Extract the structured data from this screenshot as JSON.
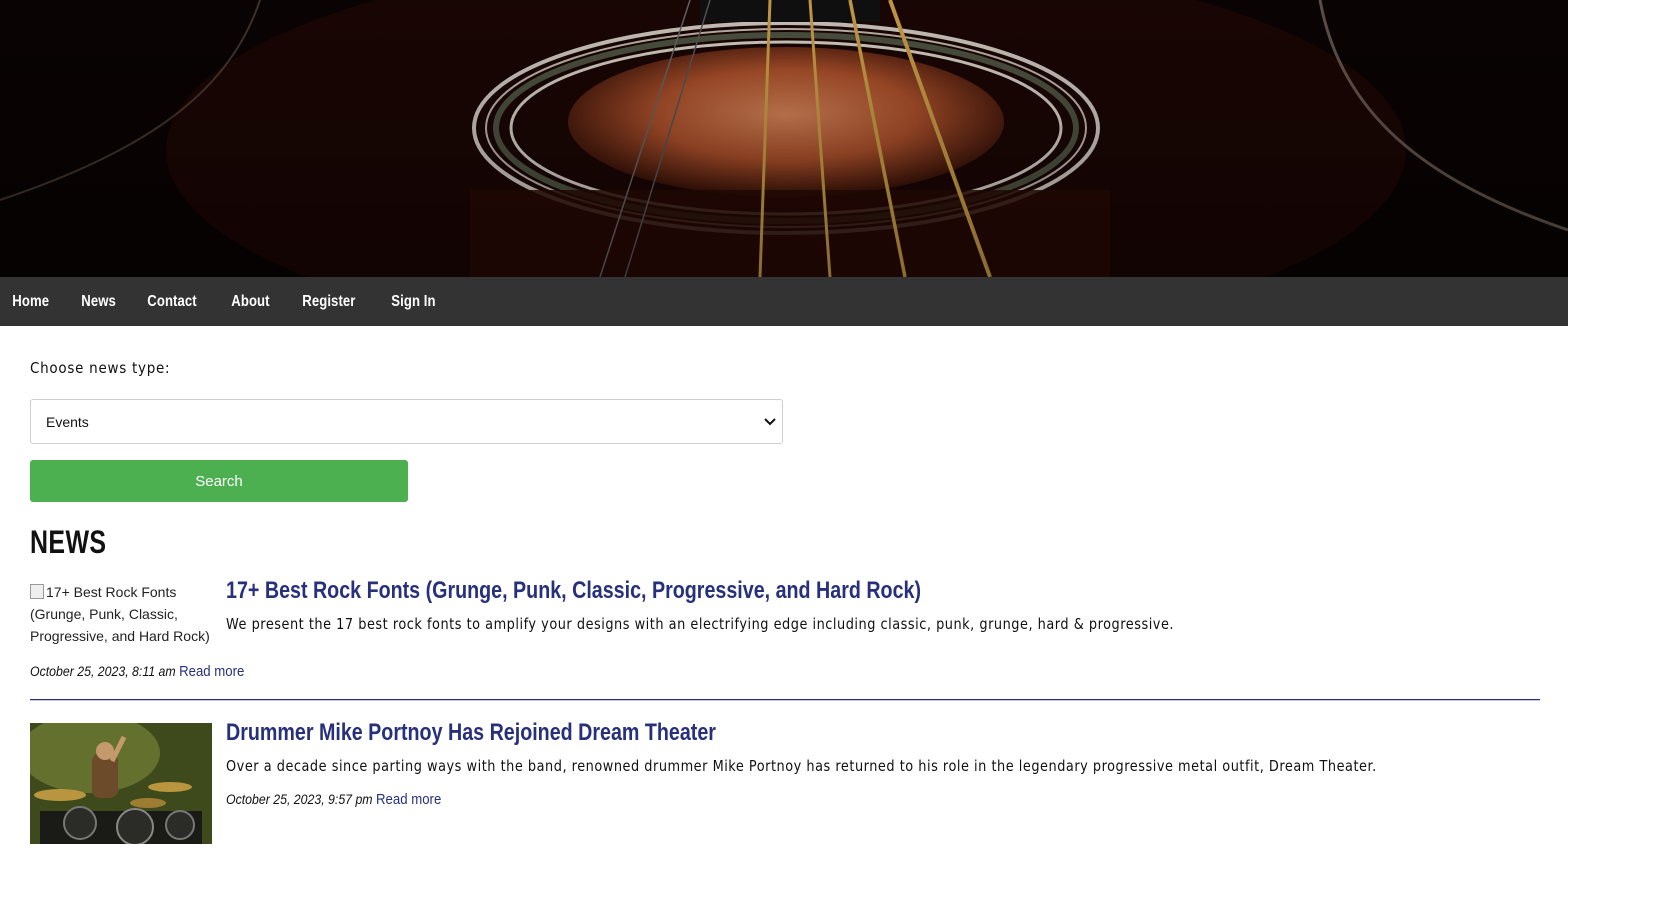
{
  "nav": {
    "items": [
      "Home",
      "News",
      "Contact",
      "About",
      "Register",
      "Sign In"
    ]
  },
  "filter": {
    "label": "Choose news type:",
    "selected": "Events",
    "search_label": "Search"
  },
  "news": {
    "heading": "NEWS",
    "articles": [
      {
        "image_alt": "17+ Best Rock Fonts (Grunge, Punk, Classic, Progressive, and Hard Rock)",
        "title": "17+ Best Rock Fonts (Grunge, Punk, Classic, Progressive, and Hard Rock)",
        "summary": "We present the 17 best rock fonts to amplify your designs with an electrifying edge including classic, punk, grunge, hard & progressive.",
        "date": "October 25, 2023, 8:11 am",
        "read_more": "Read more"
      },
      {
        "title": "Drummer Mike Portnoy Has Rejoined Dream Theater",
        "summary": "Over a decade since parting ways with the band, renowned drummer Mike Portnoy has returned to his role in the legendary progressive metal outfit, Dream Theater.",
        "date": "October 25, 2023, 9:57 pm",
        "read_more": "Read more"
      }
    ]
  },
  "colors": {
    "nav_bg": "#333333",
    "button_green": "#4caf50",
    "link_blue": "#27307a"
  }
}
